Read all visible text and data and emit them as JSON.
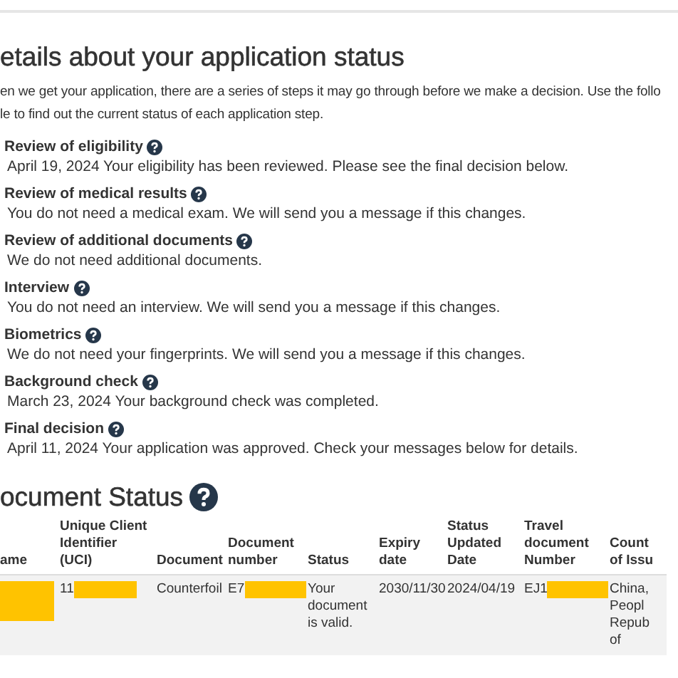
{
  "heading": "etails about your application status",
  "intro": [
    "en we get your application, there are a series of steps it may go through before we make a decision. Use the follo",
    "le to find out the current status of each application step."
  ],
  "steps": [
    {
      "title": "Review of eligibility",
      "text": "April 19, 2024 Your eligibility has been reviewed. Please see the final decision below."
    },
    {
      "title": "Review of medical results",
      "text": "You do not need a medical exam. We will send you a message if this changes."
    },
    {
      "title": "Review of additional documents",
      "text": "We do not need additional documents."
    },
    {
      "title": "Interview",
      "text": "You do not need an interview. We will send you a message if this changes."
    },
    {
      "title": "Biometrics",
      "text": "We do not need your fingerprints. We will send you a message if this changes."
    },
    {
      "title": "Background check",
      "text": "March 23, 2024 Your background check was completed."
    },
    {
      "title": "Final decision",
      "text": "April 11, 2024 Your application was approved. Check your messages below for details."
    }
  ],
  "document_status": {
    "title": "ocument Status",
    "columns": [
      "ame",
      "Unique Client\nIdentifier\n(UCI)",
      "Document",
      "Document\nnumber",
      "Status",
      "Expiry\ndate",
      "Status\nUpdated\nDate",
      "Travel\ndocument\nNumber",
      "Count\nof Issu"
    ],
    "rows": [
      [
        {
          "text": "",
          "redacted": true
        },
        {
          "text": "11",
          "redacted": true
        },
        {
          "text": "Counterfoil"
        },
        {
          "text": "E7",
          "redacted": true
        },
        {
          "text": "Your\ndocument\nis valid."
        },
        {
          "text": "2030/11/30"
        },
        {
          "text": "2024/04/19"
        },
        {
          "text": "EJ1",
          "redacted": true
        },
        {
          "text": "China,\nPeopl\nRepub\nof"
        }
      ]
    ]
  }
}
